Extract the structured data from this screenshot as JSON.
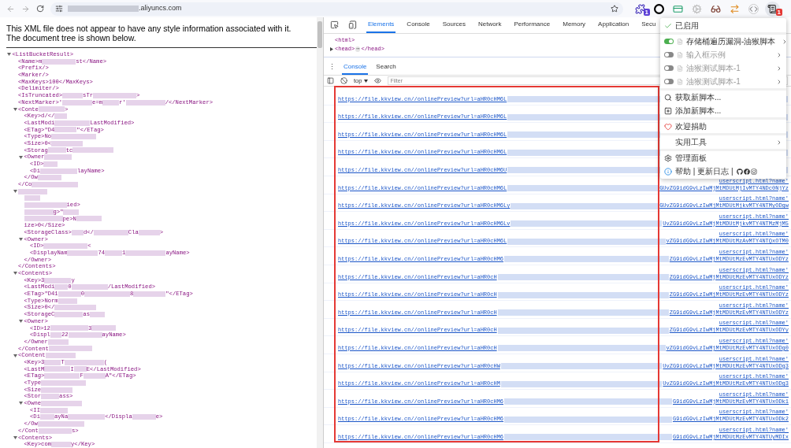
{
  "browser": {
    "url": ".aliyuncs.com",
    "extensions": [
      {
        "kind": "puzzle",
        "badge": "1",
        "color": "#5b3fd6"
      },
      {
        "kind": "ring"
      },
      {
        "kind": "card"
      },
      {
        "kind": "gear"
      },
      {
        "kind": "glasses"
      },
      {
        "kind": "arrow"
      },
      {
        "kind": "code"
      },
      {
        "kind": "script",
        "badge": "1",
        "color": "#e53935"
      }
    ]
  },
  "page": {
    "message": "This XML file does not appear to have any style information associated with it. The document tree is shown below.",
    "xml": {
      "parts": [
        "<ListBucketResult>"
      ],
      "expanded": true,
      "children": [
        {
          "parts": [
            "<Name>m",
            "st</Name>"
          ]
        },
        {
          "parts": [
            "<Prefix/>"
          ]
        },
        {
          "parts": [
            "<Marker/>"
          ]
        },
        {
          "parts": [
            "<MaxKeys>100</MaxKeys>"
          ]
        },
        {
          "parts": [
            "<Delimiter/>"
          ]
        },
        {
          "parts": [
            "<IsTruncated>",
            "sTr",
            ">"
          ]
        },
        {
          "parts": [
            "<NextMarker>'",
            "e=m",
            "r'",
            "/</NextMarker>"
          ]
        },
        {
          "parts": [
            "<Conte",
            ">"
          ],
          "expanded": true,
          "children": [
            {
              "parts": [
                "<Key>d/</"
              ],
              "trail_blurred": true
            },
            {
              "parts": [
                "<LastModi",
                "LastModified>"
              ]
            },
            {
              "parts": [
                "<ETag>\"D4",
                "\"</ETag>"
              ]
            },
            {
              "parts": [
                "<Type>No"
              ],
              "trail_blurred": true
            },
            {
              "parts": [
                "<Size>0<"
              ],
              "trail_blurred": true
            },
            {
              "parts": [
                "<Storag",
                "tc"
              ],
              "trail_blurred": true
            },
            {
              "parts": [
                "<Owner"
              ],
              "trail_blurred": true,
              "expanded": true,
              "children": [
                {
                  "parts": [
                    "<ID>"
                  ],
                  "trail_blurred": true
                },
                {
                  "parts": [
                    "<Di",
                    "layName>"
                  ]
                }
              ],
              "close": {
                "parts": [
                  "</Ow"
                ],
                "trail_blurred": true
              }
            }
          ],
          "close": {
            "parts": [
              "</Co"
            ],
            "trail_blurred": true
          }
        },
        {
          "blurred": true,
          "expanded": true,
          "children": [
            {
              "blurred": true
            },
            {
              "parts": [
                "ied>"
              ],
              "lead_blurred": true
            },
            {
              "parts": [
                "g>\""
              ],
              "lead_blurred": true,
              "trail_blurred": true
            },
            {
              "parts": [
                "pe>N"
              ],
              "lead_blurred": true,
              "trail_blurred": true
            },
            {
              "parts": [
                "ize>0</Size>"
              ]
            },
            {
              "parts": [
                "<StorageClass>",
                "d</",
                "Cla",
                ">"
              ]
            },
            {
              "parts": [
                "<Owner>"
              ],
              "expanded": true,
              "children": [
                {
                  "parts": [
                    "<ID>",
                    "<"
                  ]
                },
                {
                  "parts": [
                    "<DisplayNam",
                    "74",
                    "1",
                    "ayName>"
                  ]
                }
              ],
              "close": {
                "parts": [
                  "</Owner>"
                ]
              }
            }
          ],
          "close": {
            "parts": [
              "</Contents>"
            ]
          }
        },
        {
          "parts": [
            "<Contents>"
          ],
          "expanded": true,
          "children": [
            {
              "parts": [
                "<Key>3",
                "y"
              ]
            },
            {
              "parts": [
                "<LastModi",
                "0",
                "/LastModified>"
              ]
            },
            {
              "parts": [
                "<ETag>\"D41",
                "0",
                "8",
                "\"</ETag>"
              ]
            },
            {
              "parts": [
                "<Type>Norm"
              ],
              "trail_blurred": true
            },
            {
              "parts": [
                "<Size>0</"
              ],
              "trail_blurred": true
            },
            {
              "parts": [
                "<StorageC",
                "as"
              ],
              "trail_blurred": true
            },
            {
              "parts": [
                "<Owner>"
              ],
              "expanded": true,
              "children": [
                {
                  "parts": [
                    "<ID>12",
                    "3"
                  ],
                  "trail_blurred": true
                },
                {
                  "parts": [
                    "<Displ",
                    "22",
                    "ayName>"
                  ]
                }
              ],
              "close": {
                "parts": [
                  "</Owner"
                ],
                "trail_blurred": true
              }
            }
          ],
          "close": {
            "parts": [
              "</Content"
            ],
            "trail_blurred": true
          }
        },
        {
          "parts": [
            "<Content"
          ],
          "trail_blurred": true,
          "expanded": true,
          "children": [
            {
              "parts": [
                "<Key>3",
                "T",
                "("
              ]
            },
            {
              "parts": [
                "<LastM",
                "I",
                "E</LastModified>"
              ]
            },
            {
              "parts": [
                "<ETag>",
                "F",
                "A\"</ETag>"
              ]
            },
            {
              "parts": [
                "<Type"
              ],
              "trail_blurred": true
            },
            {
              "parts": [
                "<Size"
              ],
              "trail_blurred": true
            },
            {
              "parts": [
                "<Stor",
                "ass>"
              ]
            },
            {
              "parts": [
                "<Owne"
              ],
              "trail_blurred": true,
              "expanded": true,
              "children": [
                {
                  "parts": [
                    "<II"
                  ],
                  "trail_blurred": true
                },
                {
                  "parts": [
                    "<Di",
                    "ayNa",
                    "</Displa",
                    "e>"
                  ]
                }
              ],
              "close": {
                "parts": [
                  "</Ow"
                ],
                "trail_blurred": true
              }
            }
          ],
          "close": {
            "parts": [
              "</Cont",
              "s>"
            ]
          }
        },
        {
          "parts": [
            "<Contents>"
          ],
          "expanded": true,
          "children": [
            {
              "parts": [
                "<Key>com",
                "y</Key>"
              ]
            }
          ]
        }
      ]
    }
  },
  "devtools": {
    "tabs": [
      {
        "label": "Elements",
        "selected": true
      },
      {
        "label": "Console",
        "selected": false
      },
      {
        "label": "Sources",
        "selected": false
      },
      {
        "label": "Network",
        "selected": false
      },
      {
        "label": "Performance",
        "selected": false
      },
      {
        "label": "Memory",
        "selected": false
      },
      {
        "label": "Application",
        "selected": false
      },
      {
        "label": "Secu",
        "selected": false
      }
    ],
    "elements_lines": [
      {
        "open": "<html>"
      },
      {
        "open": "<head>",
        "ellipsis": "⋯",
        "close": "</head>",
        "expanded": false
      }
    ],
    "drawer_menu": "⋮",
    "drawer_tabs": [
      {
        "label": "Console",
        "selected": true
      },
      {
        "label": "Search",
        "selected": false
      }
    ],
    "context": "top",
    "filter_placeholder": "Filter",
    "logs": [
      {
        "link": "https://file.kkview.cn//onlinePreview?url=aHR0cHM6L"
      },
      {
        "link": "https://file.kkview.cn//onlinePreview?url=aHR0cHM6L"
      },
      {
        "link": "https://file.kkview.cn//onlinePreview?url=aHR0cHM6L"
      },
      {
        "link": "https://file.kkview.cn//onlinePreview?url=aHR0cHM6L"
      },
      {
        "link": "https://file.kkview.cn//onlinePreview?url=aHR0cHM6U"
      },
      {
        "link": "https://file.kkview.cn//onlinePreview?url=aHR0cHM6L",
        "link_end": "GUvZG9idG9vLzIwMjMtMDUtMjIvMTY4NDc0NjYz",
        "source": "userscript.html?name'"
      },
      {
        "link": "https://file.kkview.cn//onlinePreview?url=aHR0cHM6Ly",
        "link_end": "GUvZG9idG9vLzIwMjMtMDUtMjkvMTY4NTMyODgw",
        "source": "userscript.html?name'"
      },
      {
        "link": "https://file.kkview.cn//onlinePreview?url=aHR0cHM6Lv",
        "link_end": "UvZG9idG9vLzIwMjMtMDUtMjkvMTY4NTMzMjM5",
        "source": "userscript.html?name'"
      },
      {
        "link": "https://file.kkview.cn//onlinePreview?url=aHR0cHM6L",
        "link_end": "vZG9idG9vLzIwMjMtMDUtMzAvMTY4NTQxOTM0",
        "source": "userscript.html?name'"
      },
      {
        "link": "https://file.kkview.cn//onlinePreview?url=aHR0cHM6",
        "link_end": "ZG9idG9vLzIwMjMtMDUtMzEvMTY4NTUxODYz",
        "source": "userscript.html?name'"
      },
      {
        "link": "https://file.kkview.cn//onlinePreview?url=aHR0cH",
        "link_end": "ZG9idG9vLzIwMjMtMDUtMzEvMTY4NTUxODYz",
        "source": "userscript.html?name'"
      },
      {
        "link": "https://file.kkview.cn//onlinePreview?url=aHR0cH",
        "link_end": "ZG9idG9vLzIwMjMtMDUtMzEvMTY4NTUxODYz",
        "source": "userscript.html?name'"
      },
      {
        "link": "https://file.kkview.cn//onlinePreview?url=aHR0cH",
        "link_end": "ZG9idG9vLzIwMjMtMDUtMzEvMTY4NTUxODYz",
        "source": "userscript.html?name'"
      },
      {
        "link": "https://file.kkview.cn//onlinePreview?url=aHR0cH",
        "link_end": "ZG9idG9vLzIwMjMtMDUtMzEvMTY4NTUxODYy",
        "source": "userscript.html?name'"
      },
      {
        "link": "https://file.kkview.cn//onlinePreview?url=aHR0cH",
        "link_end": "vZG9idG9vLzIwMjMtMDUtMzEvMTY4NTUxODg0",
        "source": "userscript.html?name'"
      },
      {
        "link": "https://file.kkview.cn//onlinePreview?url=aHR0cHW",
        "link_end": "UvZG9idG9vLzIwMjMtMDUtMzEvMTY4NTUxODg3",
        "source": "userscript.html?name'"
      },
      {
        "link": "https://file.kkview.cn//onlinePreview?url=aHR0cHM",
        "link_end": "UvZG9idG9vLzIwMjMtMDUtMzEvMTY4NTUxODg3",
        "source": "userscript.html?name'"
      },
      {
        "link": "https://file.kkview.cn//onlinePreview?url=aHR0cHM6",
        "link_end": "G9idG9vLzIwMjMtMDUtMzEvMTY4NTUxODk1",
        "source": "userscript.html?name'"
      },
      {
        "link": "https://file.kkview.cn//onlinePreview?url=aHR0cHM6",
        "link_end": "G9idG9vLzIwMjMtMDUtMzEvMTY4NTUxODk2",
        "source": "userscript.html?name'"
      },
      {
        "link": "https://file.kkview.cn//onlinePreview?url=aHR0cHM6",
        "link_end": "G9idG9vLzIwMjMtMDUtMzEvMTY4NTUyMDIx",
        "source": "userscript.html?name'"
      }
    ]
  },
  "menu": {
    "sections": [
      [
        {
          "kind": "status",
          "label": "已启用"
        }
      ],
      [
        {
          "kind": "script",
          "label": "存储桶遍历漏洞-油猴脚本",
          "on": true
        },
        {
          "kind": "script",
          "label": "输入框示例",
          "on": false
        },
        {
          "kind": "script",
          "label": "油猴测试脚本-1",
          "on": false
        },
        {
          "kind": "script",
          "label": "油猴测试脚本-1",
          "on": false
        }
      ],
      [
        {
          "kind": "search",
          "label": "获取新脚本..."
        },
        {
          "kind": "add",
          "label": "添加新脚本..."
        }
      ],
      [
        {
          "kind": "donate",
          "label": "欢迎捐助"
        }
      ],
      [
        {
          "kind": "tools",
          "label": "实用工具"
        }
      ],
      [
        {
          "kind": "settings",
          "label": "管理面板"
        },
        {
          "kind": "help",
          "label": "帮助 | 更新日志 |"
        }
      ]
    ]
  }
}
